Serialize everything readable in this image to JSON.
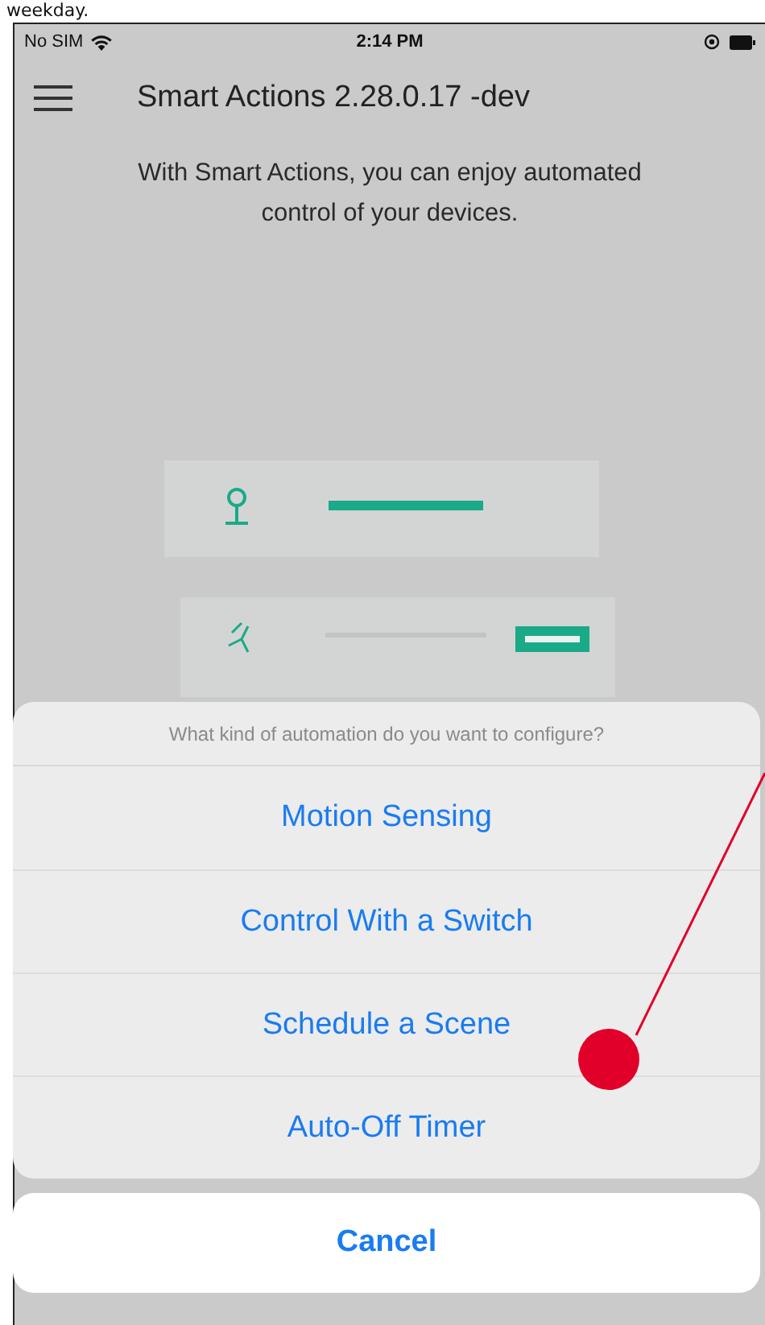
{
  "caption": "weekday.",
  "status_bar": {
    "carrier": "No SIM",
    "time": "2:14 PM"
  },
  "header": {
    "title": "Smart Actions 2.28.0.17 -dev"
  },
  "intro": "With Smart Actions, you can enjoy automated control of your devices.",
  "action_sheet": {
    "prompt": "What kind of automation do you want to configure?",
    "options": [
      {
        "label": "Motion Sensing"
      },
      {
        "label": "Control With a Switch"
      },
      {
        "label": "Schedule a Scene"
      },
      {
        "label": "Auto-Off Timer"
      }
    ],
    "cancel": "Cancel"
  }
}
